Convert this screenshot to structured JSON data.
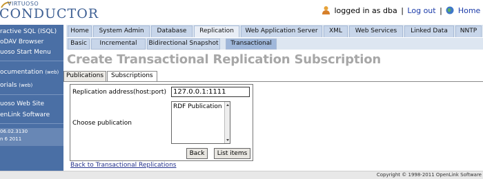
{
  "logo": {
    "small": "VIRTUOSO",
    "big": "CONDUCTOR"
  },
  "userbar": {
    "status": "logged in as dba",
    "separator": "|",
    "logout": "Log out",
    "home": "Home"
  },
  "sidebar": {
    "items": [
      "ractive SQL (ISQL)",
      "oDAV Browser",
      "uoso Start Menu",
      "ocumentation",
      "orials",
      "uoso Web Site",
      "enLink Software"
    ],
    "web_tag": "(web)",
    "version_line1": "06.02.3130",
    "version_line2": "n 6 2011"
  },
  "main_tabs": [
    "Home",
    "System Admin",
    "Database",
    "Replication",
    "Web Application Server",
    "XML",
    "Web Services",
    "Linked Data",
    "NNTP"
  ],
  "sub_tabs": [
    "Basic",
    "Incremental",
    "Bidirectional Snapshot",
    "Transactional"
  ],
  "page_title": "Create Transactional Replication Subscription",
  "inner_tabs": [
    "Publications",
    "Subscriptions"
  ],
  "form": {
    "address_label": "Replication address(host:port)",
    "address_value": "127.0.0.1:1111",
    "publication_label": "Choose publication",
    "publication_option": "RDF Publication",
    "back_button": "Back",
    "list_button": "List items"
  },
  "back_link": "Back to Transactional Replications",
  "copyright": "Copyright © 1998-2011 OpenLink Software",
  "colors": {
    "sidebar": "#4a6fa5",
    "title": "#a7a7a7",
    "link": "#1a3aa8",
    "tab": "#c8d6ea"
  }
}
